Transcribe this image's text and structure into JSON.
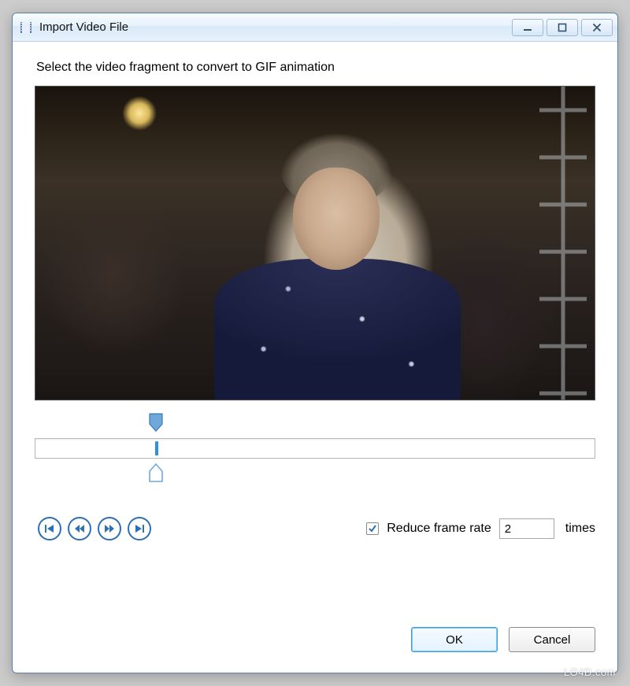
{
  "window": {
    "title": "Import Video File"
  },
  "instruction": "Select the video fragment to convert to GIF animation",
  "timeline": {
    "position_percent": 22
  },
  "controls": {
    "skip_first_title": "Go to start",
    "rewind_title": "Step back",
    "forward_title": "Step forward",
    "skip_last_title": "Go to end"
  },
  "reduce": {
    "checked": true,
    "label": "Reduce frame rate",
    "value": "2",
    "suffix": "times"
  },
  "buttons": {
    "ok": "OK",
    "cancel": "Cancel"
  },
  "watermark": "LO4D.com"
}
